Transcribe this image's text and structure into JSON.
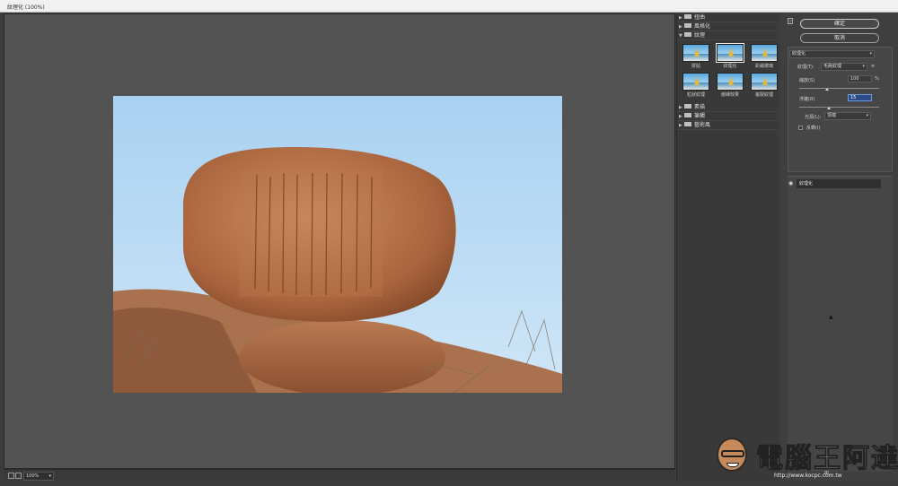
{
  "window": {
    "title": "紋理化 (100%)"
  },
  "canvas": {
    "zoom": "100%"
  },
  "filter_gallery": {
    "categories_top": [
      {
        "label": "扭曲",
        "expanded": false
      },
      {
        "label": "風格化",
        "expanded": false
      },
      {
        "label": "紋理",
        "expanded": true
      }
    ],
    "thumbnails": [
      {
        "label": "拼貼"
      },
      {
        "label": "紋理化",
        "selected": true
      },
      {
        "label": "彩繪玻璃"
      },
      {
        "label": "粒狀紋理"
      },
      {
        "label": "嵌磚效果"
      },
      {
        "label": "龜裂紋理"
      }
    ],
    "categories_bottom": [
      {
        "label": "素描",
        "expanded": false
      },
      {
        "label": "筆觸",
        "expanded": false
      },
      {
        "label": "藝術風",
        "expanded": false
      }
    ]
  },
  "buttons": {
    "ok": "確定",
    "cancel": "取消"
  },
  "settings": {
    "filter_select": "紋理化",
    "texture_label": "紋理(T):",
    "texture_value": "毛氈紋理",
    "texture_menu_icon": "≡",
    "scaling_label": "縮放(S)",
    "scaling_value": "100",
    "scaling_unit": "%",
    "relief_label": "浮雕(R)",
    "relief_value": "15",
    "light_label": "光源(L):",
    "light_value": "頂端",
    "invert_label": "反轉(I)"
  },
  "layer": {
    "name": "紋理化"
  },
  "watermark": {
    "text": "電腦王阿達",
    "url": "http://www.kocpc.com.tw"
  }
}
